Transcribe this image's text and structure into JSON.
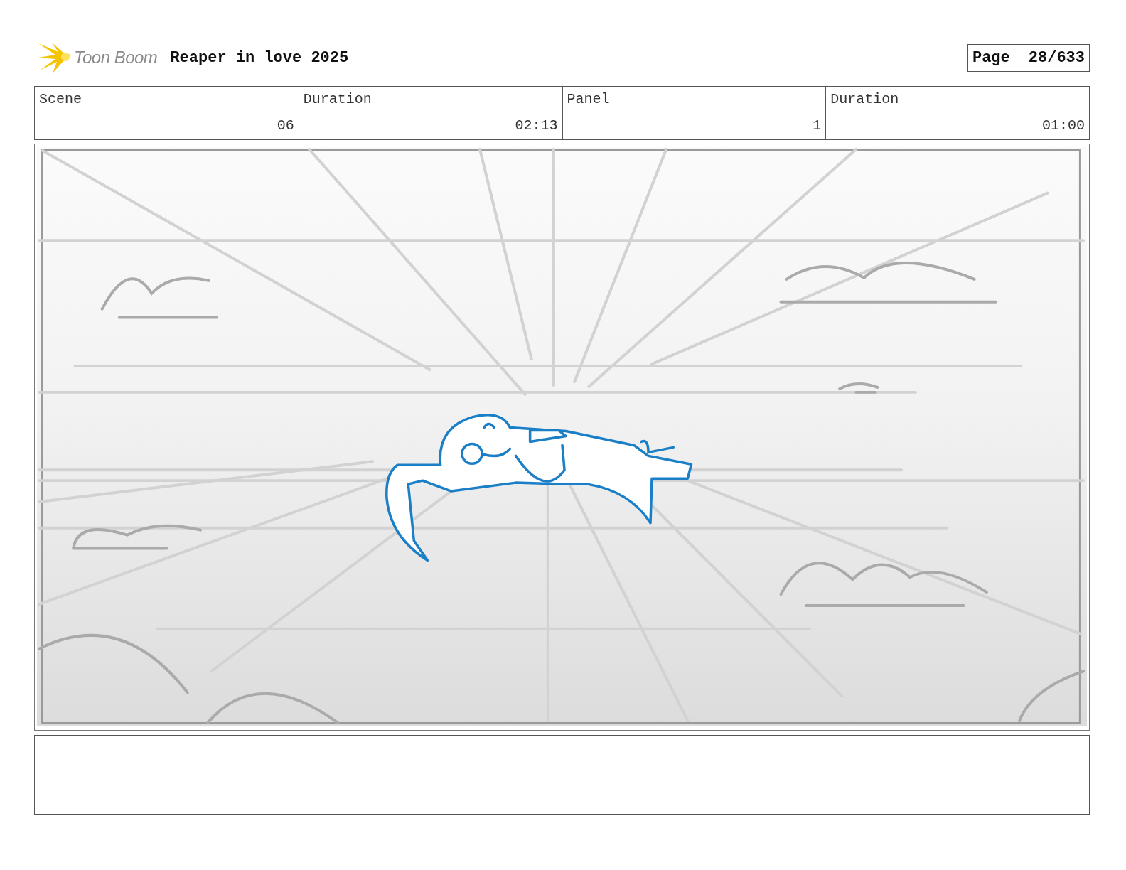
{
  "header": {
    "logo_text": "Toon Boom",
    "title": "Reaper in love 2025",
    "page_label": "Page",
    "page_number": "28/633"
  },
  "info_table": {
    "columns": [
      "Scene",
      "Duration",
      "Panel",
      "Duration"
    ],
    "rows": [
      [
        "06",
        "02:13",
        "1",
        "01:00"
      ]
    ]
  }
}
